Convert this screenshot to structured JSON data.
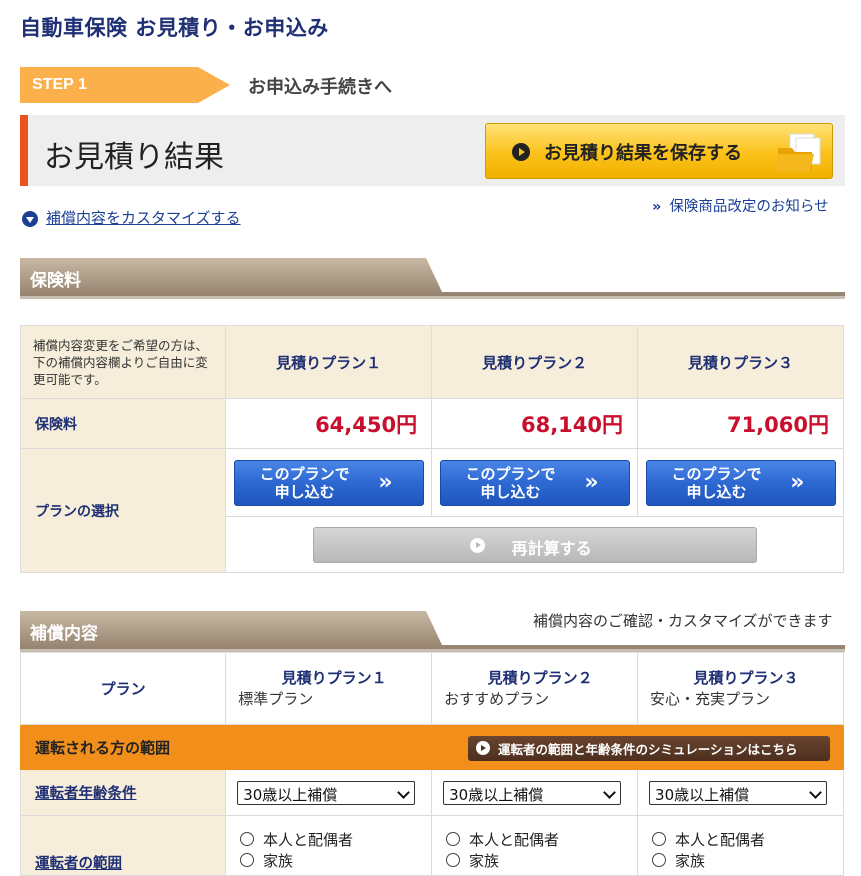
{
  "header": {
    "title": "自動車保険 お見積り・お申込み"
  },
  "step": {
    "label": "STEP 1",
    "text": "お申込み手続きへ"
  },
  "result": {
    "title": "お見積り結果",
    "save_label": "お見積り結果を保存する"
  },
  "links": {
    "customize": "補償内容をカスタマイズする",
    "notice_mark": "»",
    "notice": "保険商品改定のお知らせ"
  },
  "premium_section": {
    "tab": "保険料",
    "note": "補償内容変更をご希望の方は、下の補償内容欄よりご自由に変更可能です。",
    "plans": [
      "見積りプラン１",
      "見積りプラン２",
      "見積りプラン３"
    ],
    "premium_label": "保険料",
    "prices": [
      "64,450円",
      "68,140円",
      "71,060円"
    ],
    "select_label": "プランの選択",
    "apply_line1": "このプランで",
    "apply_line2": "申し込む",
    "apply_arrow": "»",
    "recalc_label": "再計算する"
  },
  "coverage_section": {
    "tab": "補償内容",
    "note": "補償内容のご確認・カスタマイズができます",
    "plan_label": "プラン",
    "plans": [
      {
        "name": "見積りプラン１",
        "sub": "標準プラン"
      },
      {
        "name": "見積りプラン２",
        "sub": "おすすめプラン"
      },
      {
        "name": "見積りプラン３",
        "sub": "安心・充実プラン"
      }
    ],
    "driver_scope_header": "運転される方の範囲",
    "sim_button": "運転者の範囲と年齢条件のシミュレーションはこちら",
    "age_label": "運転者年齢条件",
    "age_values": [
      "30歳以上補償",
      "30歳以上補償",
      "30歳以上補償"
    ],
    "scope_label": "運転者の範囲",
    "scope_options": [
      "本人と配偶者",
      "家族"
    ]
  },
  "colors": {
    "navy": "#1e2f73",
    "price_red": "#c8102e",
    "orange": "#f28f1b",
    "step_orange": "#fbb04b"
  }
}
